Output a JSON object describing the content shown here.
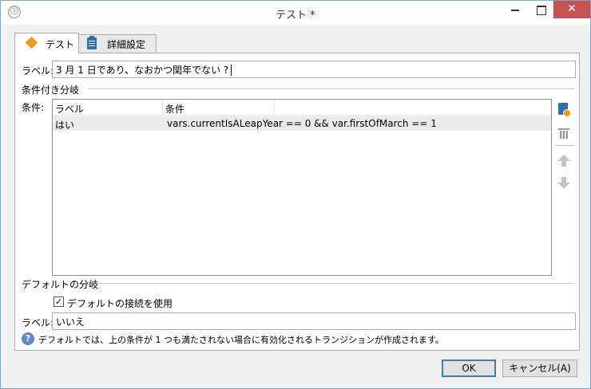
{
  "window": {
    "title": "テスト *",
    "close_glyph": "✕"
  },
  "tabs": [
    {
      "label": "テスト",
      "icon": "diamond-icon",
      "active": true
    },
    {
      "label": "詳細設定",
      "icon": "clipboard-icon",
      "active": false
    }
  ],
  "label_field": {
    "label": "ラベル:",
    "value": "3 月 1 日であり、なおかつ閏年でない ?"
  },
  "conditional": {
    "section_title": "条件付き分岐",
    "conditions_label": "条件:",
    "columns": [
      "ラベル",
      "条件"
    ],
    "rows": [
      {
        "label": "はい",
        "condition": "vars.currentIsALeapYear == 0 && var.firstOfMarch == 1"
      }
    ]
  },
  "default_branch": {
    "section_title": "デフォルトの分岐",
    "checkbox_label": "デフォルトの接続を使用",
    "checkbox_checked": true,
    "checkmark": "✓",
    "label_label": "ラベル:",
    "label_value": "いいえ",
    "help_glyph": "?",
    "help_text": "デフォルトでは、上の条件が 1 つも満たされない場合に有効化されるトランジションが作成されます。"
  },
  "buttons": {
    "ok": "OK",
    "cancel": "キャンセル(A)"
  },
  "colors": {
    "accent": "#f39c12",
    "icon_blue": "#2e6fb5",
    "close_red": "#c75050"
  }
}
